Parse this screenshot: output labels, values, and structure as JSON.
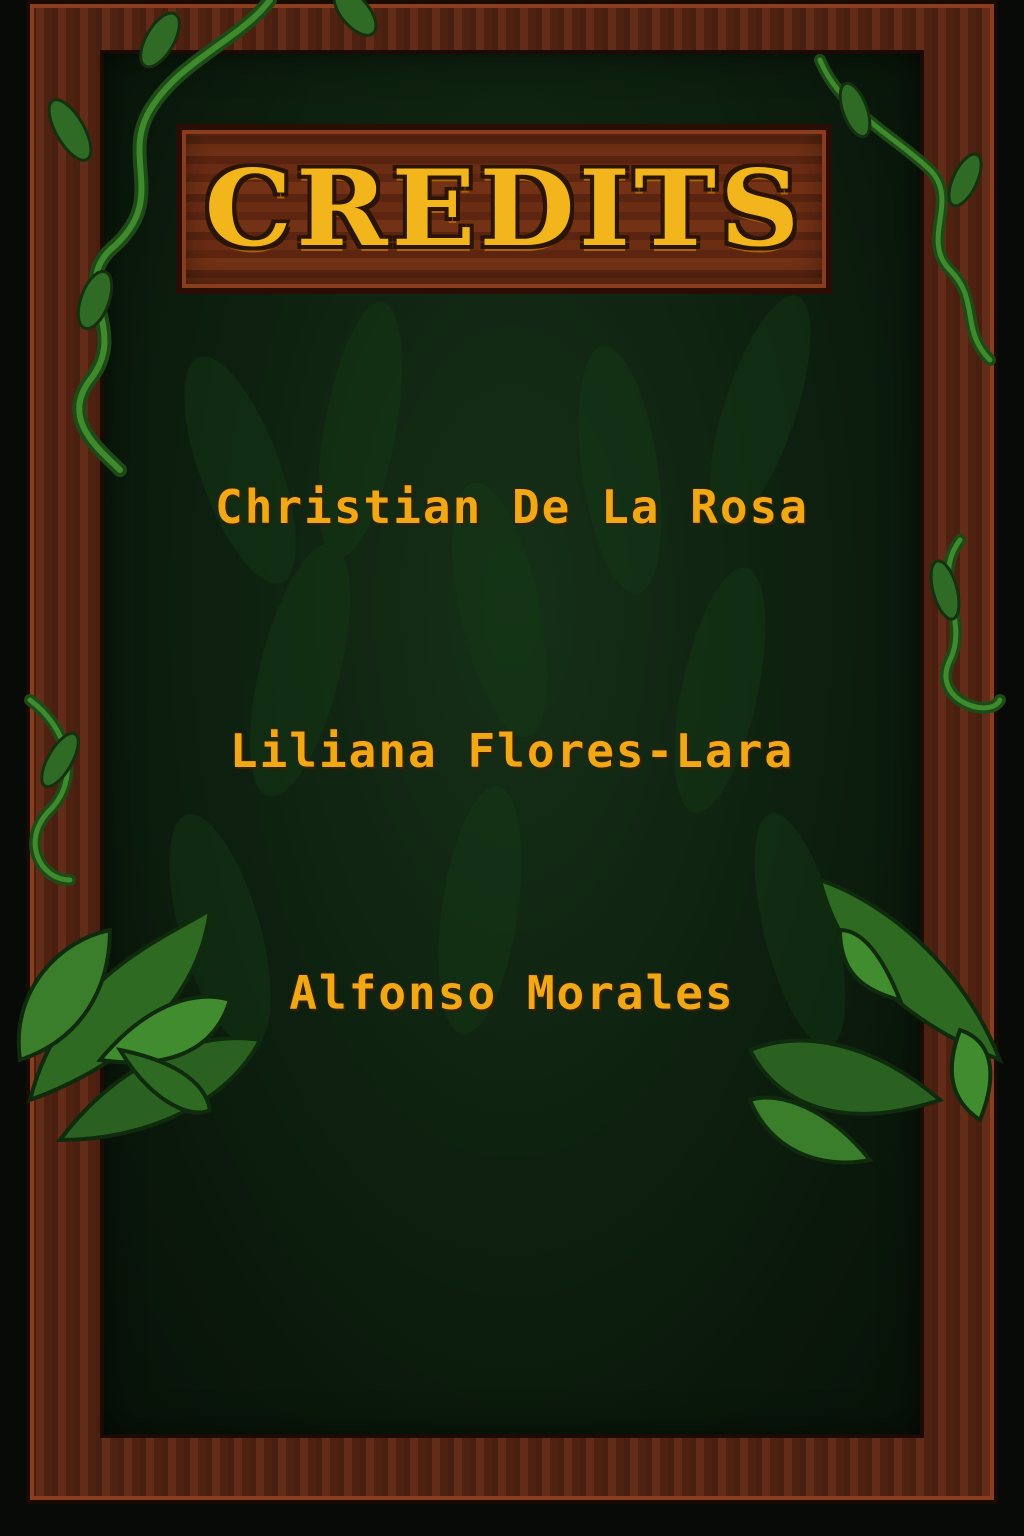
{
  "screen": {
    "title": "CREDITS",
    "names": [
      "Christian De La Rosa",
      "Liliana Flores-Lara",
      "Alfonso Morales"
    ]
  },
  "colors": {
    "wood": "#5a2614",
    "title_gold": "#f2b51c",
    "name_gold": "#f0a814",
    "background": "#0e2210",
    "leaf_green": "#2f6b24"
  },
  "icons": [
    "vine-icon",
    "leaf-cluster-icon"
  ]
}
